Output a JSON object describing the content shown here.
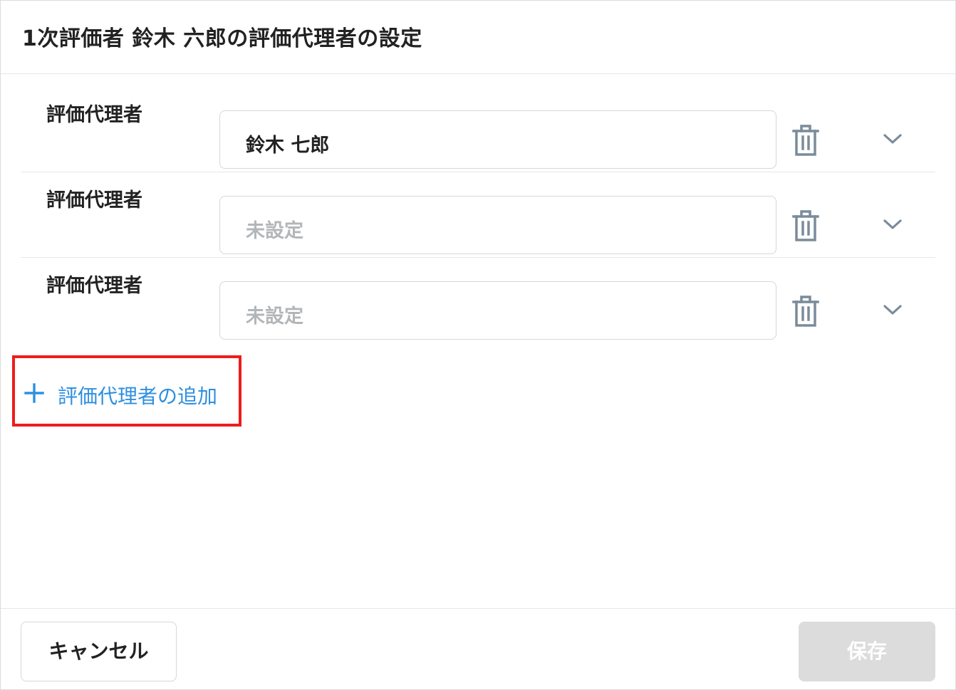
{
  "dialog": {
    "title": "1次評価者 鈴木 六郎の評価代理者の設定"
  },
  "rows": [
    {
      "label": "評価代理者",
      "value": "鈴木 七郎",
      "placeholder": ""
    },
    {
      "label": "評価代理者",
      "value": "",
      "placeholder": "未設定"
    },
    {
      "label": "評価代理者",
      "value": "",
      "placeholder": "未設定"
    }
  ],
  "add_button": {
    "label": "評価代理者の追加",
    "highlight_color": "#ee1c1c"
  },
  "footer": {
    "cancel_label": "キャンセル",
    "save_label": "保存"
  },
  "icons": {
    "delete": "trash-icon",
    "expand": "chevron-down-icon",
    "add": "plus-icon"
  },
  "colors": {
    "accent": "#2e8fe0",
    "text": "#222222",
    "placeholder": "#b3b6b9",
    "icon": "#7a8b9a",
    "disabled_button": "#dcdcdc"
  }
}
